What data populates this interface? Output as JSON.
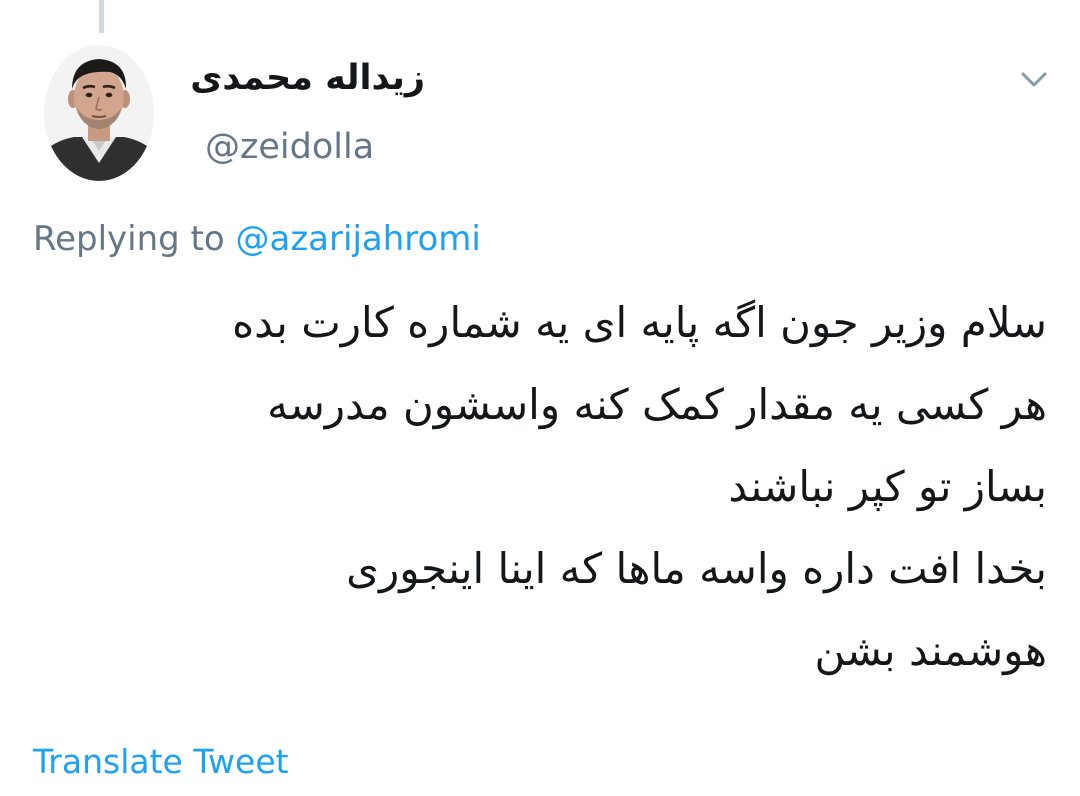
{
  "tweet": {
    "author": {
      "display_name": "زیداله محمدی",
      "handle": "@zeidolla"
    },
    "reply": {
      "prefix": "Replying to",
      "target": "@azarijahromi"
    },
    "text_lines": [
      "سلام وزیر جون اگه پایه ای یه شماره کارت بده",
      "هر کسی یه مقدار کمک کنه واسشون مدرسه",
      "بساز تو کپر نباشند",
      "بخدا افت داره واسه ماها که اینا اینجوری",
      "هوشمند بشن"
    ],
    "translate_label": "Translate Tweet"
  },
  "icons": {
    "menu": "chevron-down-icon",
    "avatar": "profile-photo"
  },
  "colors": {
    "text_primary": "#14171a",
    "text_secondary": "#657786",
    "link": "#1da1f2",
    "thread_line": "#cfd9de"
  }
}
